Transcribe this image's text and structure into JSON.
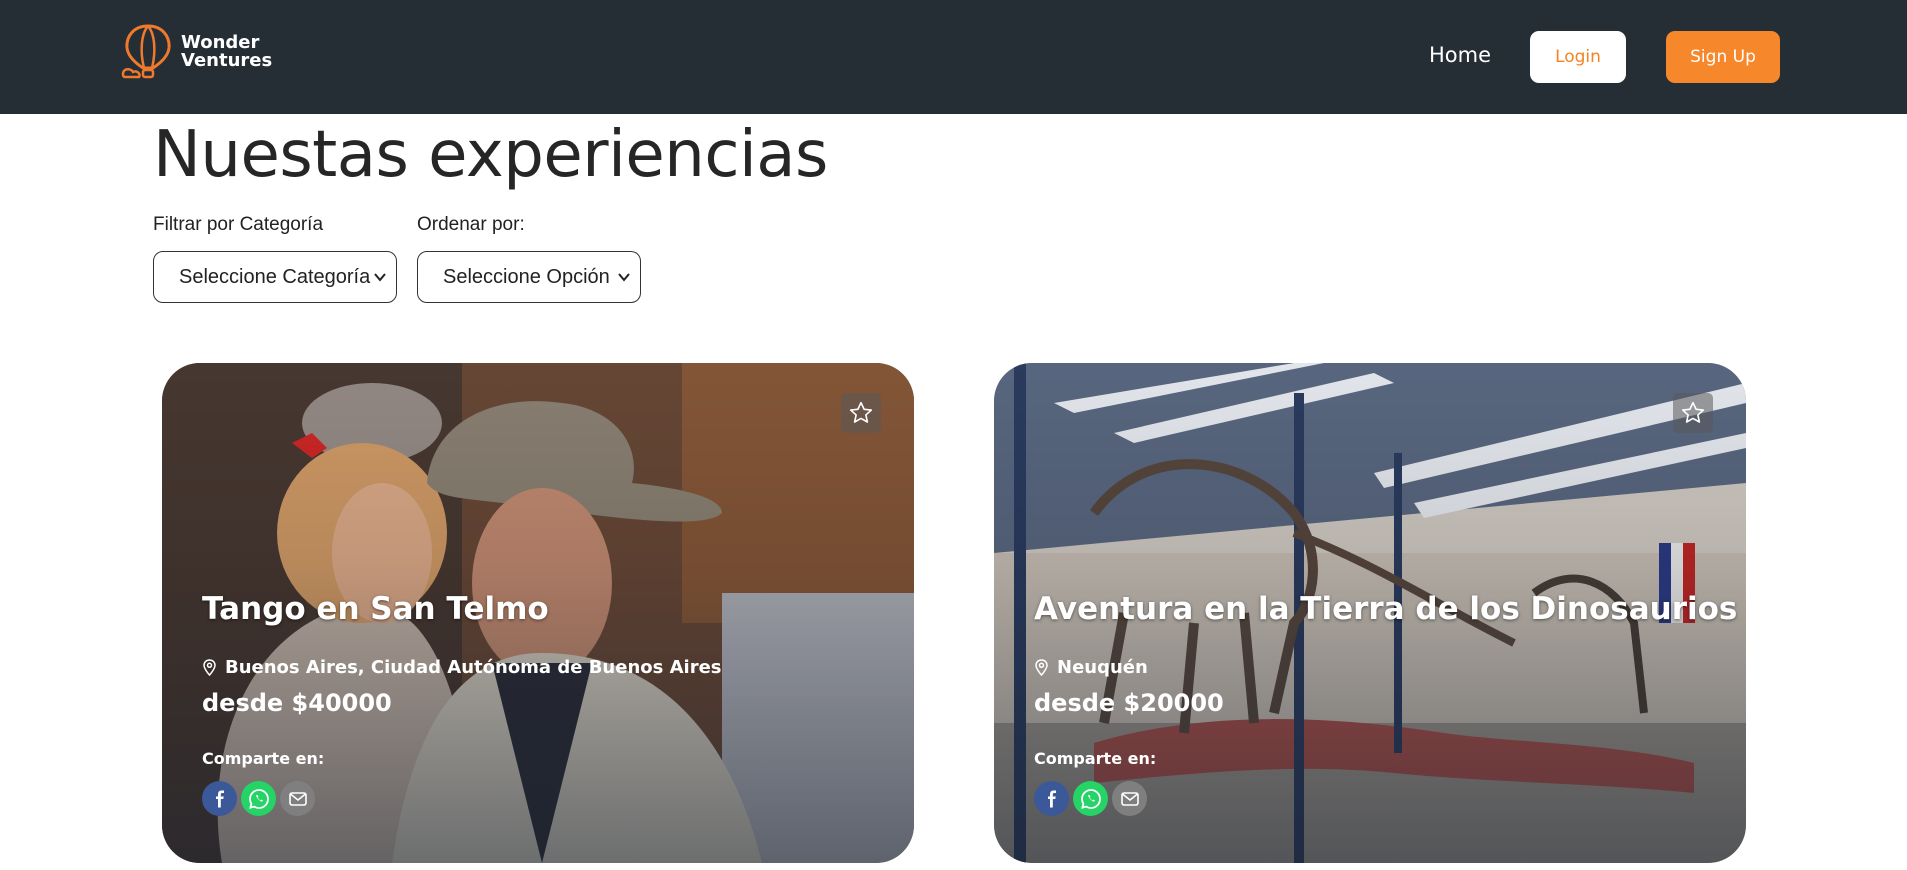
{
  "header": {
    "logo_line1": "Wonder",
    "logo_line2": "Ventures",
    "nav_home": "Home",
    "login_label": "Login",
    "signup_label": "Sign Up"
  },
  "main": {
    "title": "Nuestas experiencias",
    "filter_label": "Filtrar por Categoría",
    "filter_value": "Seleccione Categoría",
    "sort_label": "Ordenar por:",
    "sort_value": "Seleccione Opción"
  },
  "cards": [
    {
      "title": "Tango en San Telmo",
      "location": "Buenos Aires, Ciudad Autónoma de Buenos Aires",
      "price": "desde $40000",
      "share_label": "Comparte en:"
    },
    {
      "title": "Aventura en la Tierra de los Dinosaurios",
      "location": "Neuquén",
      "price": "desde $20000",
      "share_label": "Comparte en:"
    }
  ],
  "colors": {
    "header_bg": "#252e35",
    "accent": "#f7872b"
  }
}
